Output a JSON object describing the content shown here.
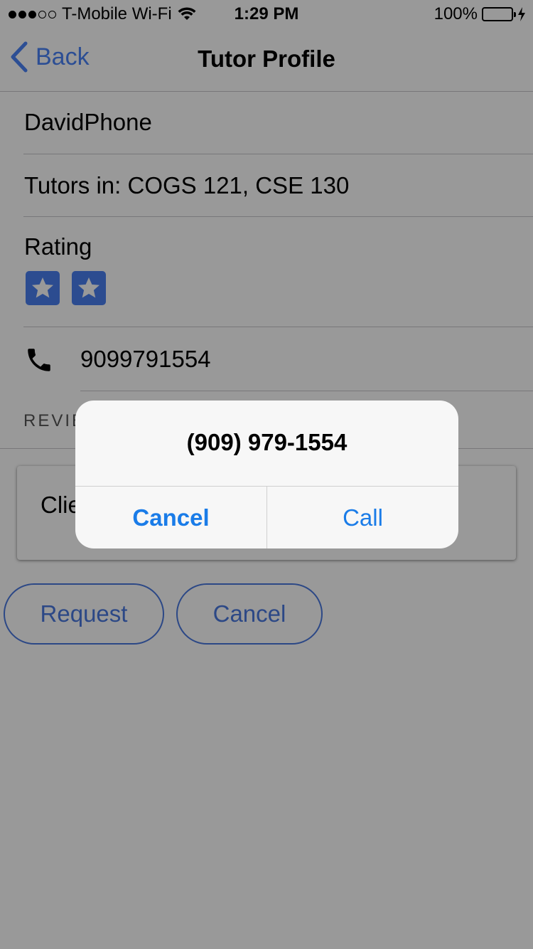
{
  "status_bar": {
    "carrier": "T-Mobile Wi-Fi",
    "time": "1:29 PM",
    "battery": "100%"
  },
  "nav": {
    "back_label": "Back",
    "title": "Tutor Profile"
  },
  "profile": {
    "name": "DavidPhone",
    "tutors_in": "Tutors in: COGS 121, CSE 130",
    "rating_label": "Rating",
    "rating_stars": 2,
    "phone": "9099791554"
  },
  "reviews": {
    "header": "REVIE",
    "card_text": "Clie"
  },
  "actions": {
    "request_label": "Request",
    "cancel_label": "Cancel"
  },
  "alert": {
    "message": "(909) 979-1554",
    "cancel_label": "Cancel",
    "call_label": "Call"
  },
  "colors": {
    "accent": "#4a7ff0",
    "alert_button": "#1a7ce8",
    "battery": "#4cd964"
  }
}
